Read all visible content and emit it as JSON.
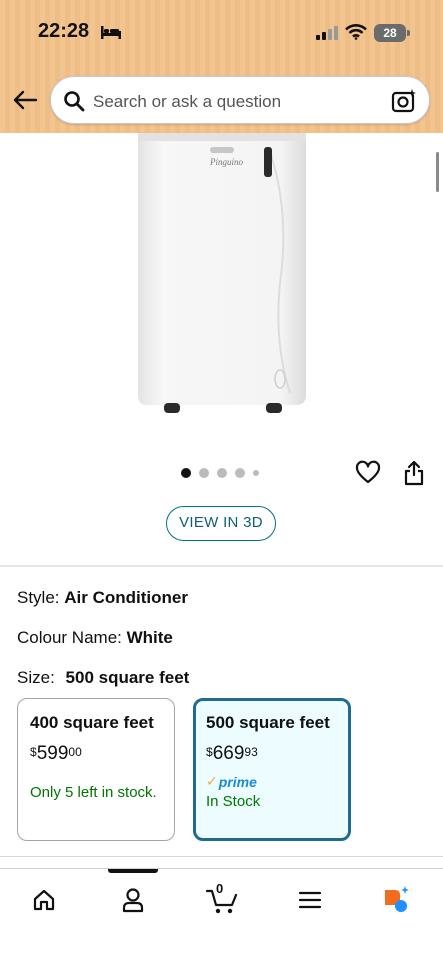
{
  "status_bar": {
    "time": "22:28",
    "battery": "28"
  },
  "search": {
    "placeholder": "Search or ask a question"
  },
  "product": {
    "carousel": {
      "dot_count": 5,
      "active_index": 0
    },
    "view_3d_label": "VIEW IN 3D"
  },
  "specs": {
    "style_label": "Style:",
    "style_value": "Air Conditioner",
    "colour_label": "Colour Name:",
    "colour_value": "White",
    "size_label": "Size:",
    "size_value": "500 square feet"
  },
  "size_options": [
    {
      "title": "400 square feet",
      "price_symbol": "$",
      "price_whole": "599",
      "price_cents": "00",
      "stock": "Only 5 left in stock."
    },
    {
      "title": "500 square feet",
      "price_symbol": "$",
      "price_whole": "669",
      "price_cents": "93",
      "prime": "prime",
      "stock": "In Stock"
    }
  ],
  "bottom_nav": {
    "cart_count": "0"
  },
  "colors": {
    "header_bg": "#f2c48f",
    "link_teal": "#007185",
    "stock_green": "#007600",
    "selected_border": "#236a90",
    "prime_blue": "#1a8bd1"
  }
}
